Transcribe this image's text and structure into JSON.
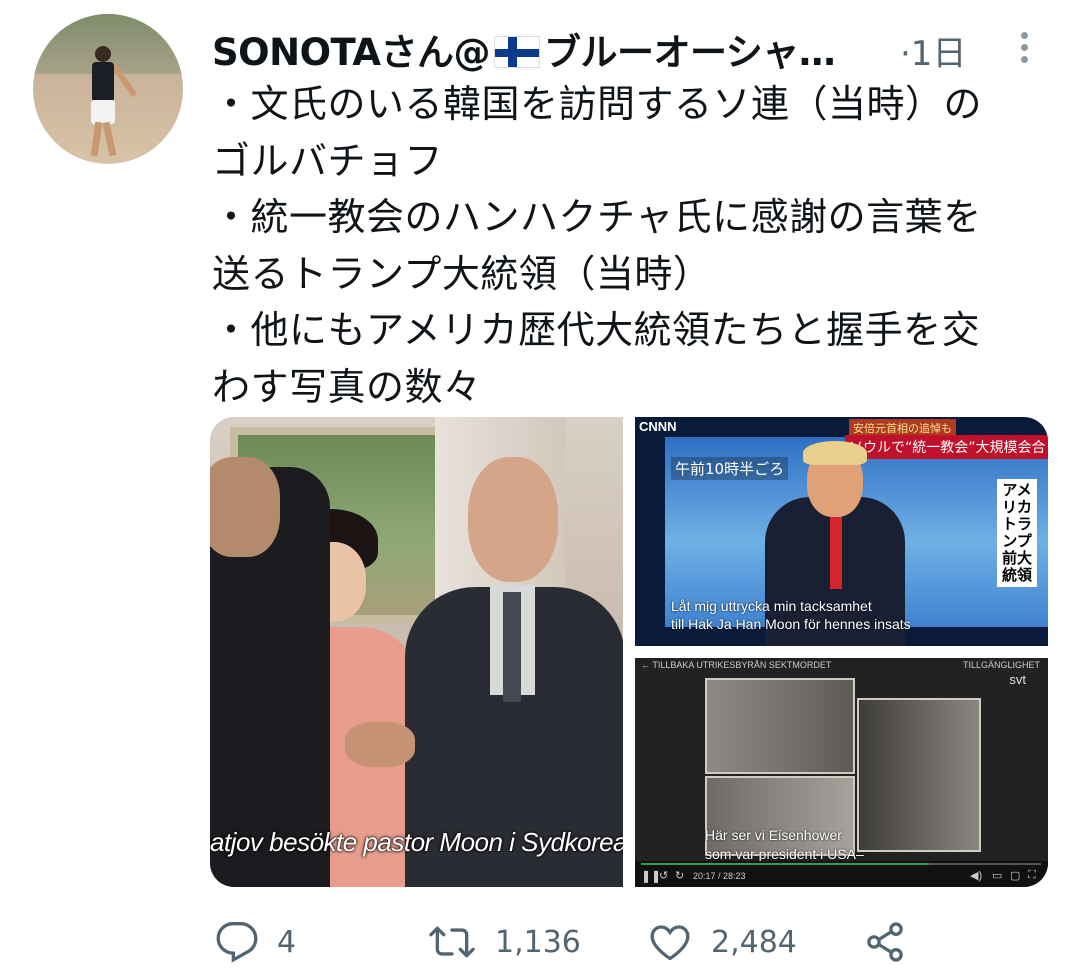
{
  "tweet": {
    "display_name": "SONOTAさん@",
    "display_name_suffix": "ブルーオーシャ…",
    "time": "·1日",
    "text": "・文氏のいる韓国を訪問するソ連（当時）の\nゴルバチョフ\n・統一教会のハンハクチャ氏に感謝の言葉を\n送るトランプ大統領（当時）\n・他にもアメリカ歴代大統領たちと握手を交\nわす写真の数々"
  },
  "media": {
    "left": {
      "subtitle": "atjov besökte pastor Moon i Sydkorea"
    },
    "right_top": {
      "logo": "CNNN",
      "caption_small": "安倍元首相の追悼も",
      "caption": "ソウルで“統一教会”大規模会合",
      "time_label": "午前10時半ごろ",
      "vertical_label": "アメリカトランプ前大統領",
      "subtitle": "Låt mig uttrycka min tacksamhet\ntill Hak Ja Han Moon för hennes insats"
    },
    "right_bottom": {
      "top_bar": "← TILLBAKA   UTRIKESBYRÅN SEKTMORDET",
      "top_bar_right": "TILLGÄNGLIGHET",
      "logo": "svt",
      "subtitle": "Här ser vi Eisenhower\nsom var president i USA–",
      "timecode": "20:17 / 28:23",
      "progress": 0.72
    }
  },
  "actions": {
    "reply_count": "4",
    "retweet_count": "1,136",
    "like_count": "2,484"
  },
  "icons": [
    "avatar",
    "finland-flag-icon",
    "more-icon",
    "reply-icon",
    "retweet-icon",
    "like-icon",
    "share-icon"
  ]
}
